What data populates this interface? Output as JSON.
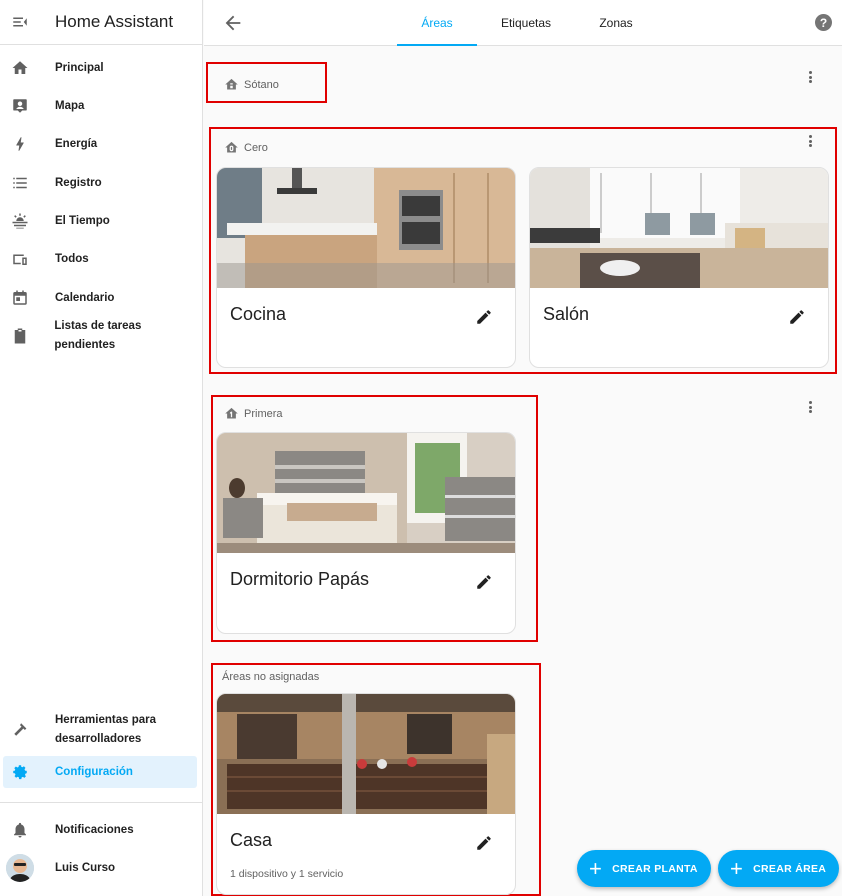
{
  "sidebar": {
    "title": "Home Assistant",
    "items": [
      {
        "label": "Principal",
        "icon": "home-icon"
      },
      {
        "label": "Mapa",
        "icon": "map-icon"
      },
      {
        "label": "Energía",
        "icon": "lightning-icon"
      },
      {
        "label": "Registro",
        "icon": "list-icon"
      },
      {
        "label": "El Tiempo",
        "icon": "weather-icon"
      },
      {
        "label": "Todos",
        "icon": "devices-icon"
      },
      {
        "label": "Calendario",
        "icon": "calendar-icon"
      },
      {
        "label": "Listas de tareas pendientes",
        "icon": "clipboard-icon"
      }
    ],
    "bottom": {
      "developer_tools_1": "Herramientas para",
      "developer_tools_2": "desarrolladores",
      "settings": "Configuración",
      "notifications": "Notificaciones",
      "user": "Luis Curso"
    }
  },
  "topbar": {
    "tabs": [
      "Áreas",
      "Etiquetas",
      "Zonas"
    ],
    "help": "?"
  },
  "floors": {
    "sotano": "Sótano",
    "cero": "Cero",
    "primera": "Primera",
    "unassigned": "Áreas no asignadas"
  },
  "areas": {
    "cocina": {
      "name": "Cocina"
    },
    "salon": {
      "name": "Salón"
    },
    "dormitorio": {
      "name": "Dormitorio Papás"
    },
    "casa": {
      "name": "Casa",
      "summary": "1 dispositivo y 1 servicio"
    }
  },
  "actions": {
    "create_floor": "CREAR PLANTA",
    "create_area": "CREAR ÁREA"
  },
  "colors": {
    "accent": "#03a9f4",
    "highlight": "#e00000"
  }
}
